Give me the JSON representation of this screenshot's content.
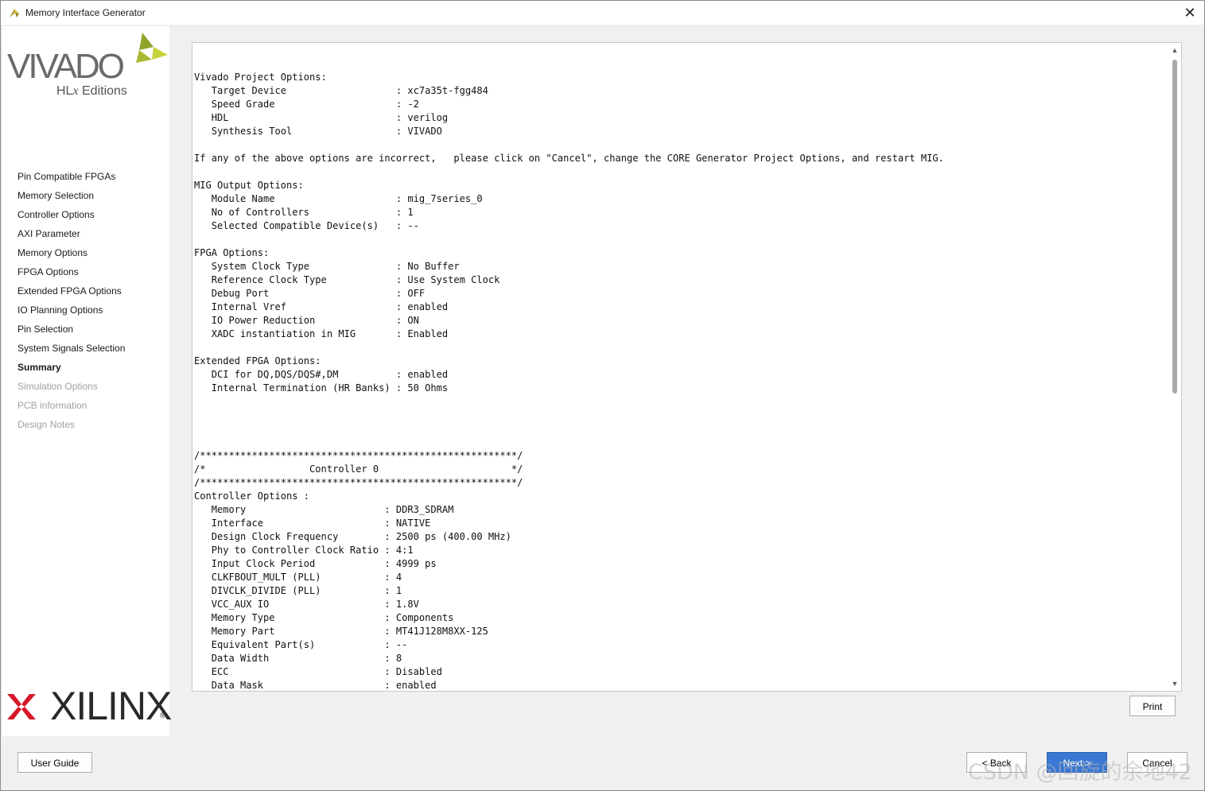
{
  "window": {
    "title": "Memory Interface Generator",
    "close_glyph": "✕"
  },
  "sidebar": {
    "logo_vivado": "VIVADO",
    "logo_hlx_prefix": "HL",
    "logo_hlx_x": "x",
    "logo_hlx_suffix": " Editions",
    "logo_xilinx": "XILINX",
    "logo_xilinx_reg": "®",
    "items": [
      {
        "label": "Pin Compatible FPGAs",
        "state": "normal"
      },
      {
        "label": "Memory Selection",
        "state": "normal"
      },
      {
        "label": "Controller Options",
        "state": "normal"
      },
      {
        "label": "AXI Parameter",
        "state": "normal"
      },
      {
        "label": "Memory Options",
        "state": "normal"
      },
      {
        "label": "FPGA Options",
        "state": "normal"
      },
      {
        "label": "Extended FPGA Options",
        "state": "normal"
      },
      {
        "label": "IO Planning Options",
        "state": "normal"
      },
      {
        "label": "Pin Selection",
        "state": "normal"
      },
      {
        "label": "System Signals Selection",
        "state": "normal"
      },
      {
        "label": "Summary",
        "state": "active"
      },
      {
        "label": "Simulation Options",
        "state": "disabled"
      },
      {
        "label": "PCB information",
        "state": "disabled"
      },
      {
        "label": "Design Notes",
        "state": "disabled"
      }
    ]
  },
  "summary": {
    "lines": [
      "Vivado Project Options:",
      "   Target Device                   : xc7a35t-fgg484",
      "   Speed Grade                     : -2",
      "   HDL                             : verilog",
      "   Synthesis Tool                  : VIVADO",
      "",
      "If any of the above options are incorrect,   please click on \"Cancel\", change the CORE Generator Project Options, and restart MIG.",
      "",
      "MIG Output Options:",
      "   Module Name                     : mig_7series_0",
      "   No of Controllers               : 1",
      "   Selected Compatible Device(s)   : --",
      "",
      "FPGA Options:",
      "   System Clock Type               : No Buffer",
      "   Reference Clock Type            : Use System Clock",
      "   Debug Port                      : OFF",
      "   Internal Vref                   : enabled",
      "   IO Power Reduction              : ON",
      "   XADC instantiation in MIG       : Enabled",
      "",
      "Extended FPGA Options:",
      "   DCI for DQ,DQS/DQS#,DM          : enabled",
      "   Internal Termination (HR Banks) : 50 Ohms",
      "",
      "",
      "",
      "",
      "/*******************************************************/",
      "/*                  Controller 0                       */",
      "/*******************************************************/",
      "Controller Options :",
      "   Memory                        : DDR3_SDRAM",
      "   Interface                     : NATIVE",
      "   Design Clock Frequency        : 2500 ps (400.00 MHz)",
      "   Phy to Controller Clock Ratio : 4:1",
      "   Input Clock Period            : 4999 ps",
      "   CLKFBOUT_MULT (PLL)           : 4",
      "   DIVCLK_DIVIDE (PLL)           : 1",
      "   VCC_AUX IO                    : 1.8V",
      "   Memory Type                   : Components",
      "   Memory Part                   : MT41J128M8XX-125",
      "   Equivalent Part(s)            : --",
      "   Data Width                    : 8",
      "   ECC                           : Disabled",
      "   Data Mask                     : enabled"
    ]
  },
  "buttons": {
    "print": "Print",
    "user_guide": "User Guide",
    "back": "< Back",
    "next": "Next >",
    "cancel": "Cancel"
  },
  "colors": {
    "accent": "#3a78d4",
    "xilinx_red": "#d7182a",
    "vivado_green": "#b5c532"
  },
  "watermark": "CSDN @回旋的余地42"
}
